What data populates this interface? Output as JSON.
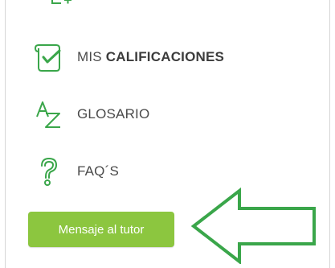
{
  "menu": {
    "items": [
      {
        "icon": "scroll-check-icon",
        "label_prefix": "MIS",
        "label_bold": "CALIFICACIONES"
      },
      {
        "icon": "az-glossary-icon",
        "label": "GLOSARIO"
      },
      {
        "icon": "question-mark-icon",
        "label": "FAQ´S"
      }
    ]
  },
  "tutor_button": {
    "label": "Mensaje al tutor",
    "color": "#8cc63f"
  },
  "accent_color": "#3aa64a",
  "annotation": {
    "icon": "arrow-left-icon",
    "color": "#3aa64a"
  }
}
